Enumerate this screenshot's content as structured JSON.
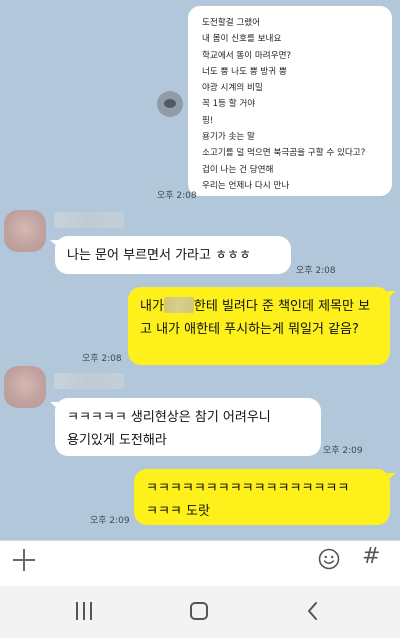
{
  "messages": {
    "list_bubble": {
      "lines": [
        "도전할걸 그랬어",
        "내 몸이 신호를 보내요",
        "학교에서 똥이 마려우면?",
        "너도 뿡 나도 뿡 방귀 뿡",
        "야광 시계의 비밀",
        "꼭 1등 할 거야",
        "핑!",
        "용기가 솟는 말",
        "소고기를 덜 먹으면 북극곰을 구할 수 있다고?",
        "겁이 나는 건 당연해",
        "우리는 언제나 다시 만나"
      ],
      "time": "오후 2:08"
    },
    "msg1": {
      "text": "나는 문어 부르면서 가라고 ㅎㅎㅎ",
      "time": "오후 2:08"
    },
    "msg2": {
      "text_a": "내가",
      "text_b": "한테 빌려다 준 책인데 제목만 보고 내가 애한테 푸시하는게 뭐일거 같음?",
      "time": "오후 2:08"
    },
    "msg3": {
      "text": "ㅋㅋㅋㅋㅋ 생리현상은 참기 어려우니\n용기있게 도전해라",
      "time": "오후 2:09"
    },
    "msg4": {
      "text": "ㅋㅋㅋㅋㅋㅋㅋㅋㅋㅋㅋㅋㅋㅋㅋㅋㅋ\nㅋㅋㅋ 도랏",
      "time": "오후 2:09"
    }
  },
  "input_bar": {
    "hash_symbol": "#"
  },
  "colors": {
    "chat_bg": "#b2c7da",
    "yellow_bubble": "#fef01b",
    "white_bubble": "#ffffff"
  }
}
